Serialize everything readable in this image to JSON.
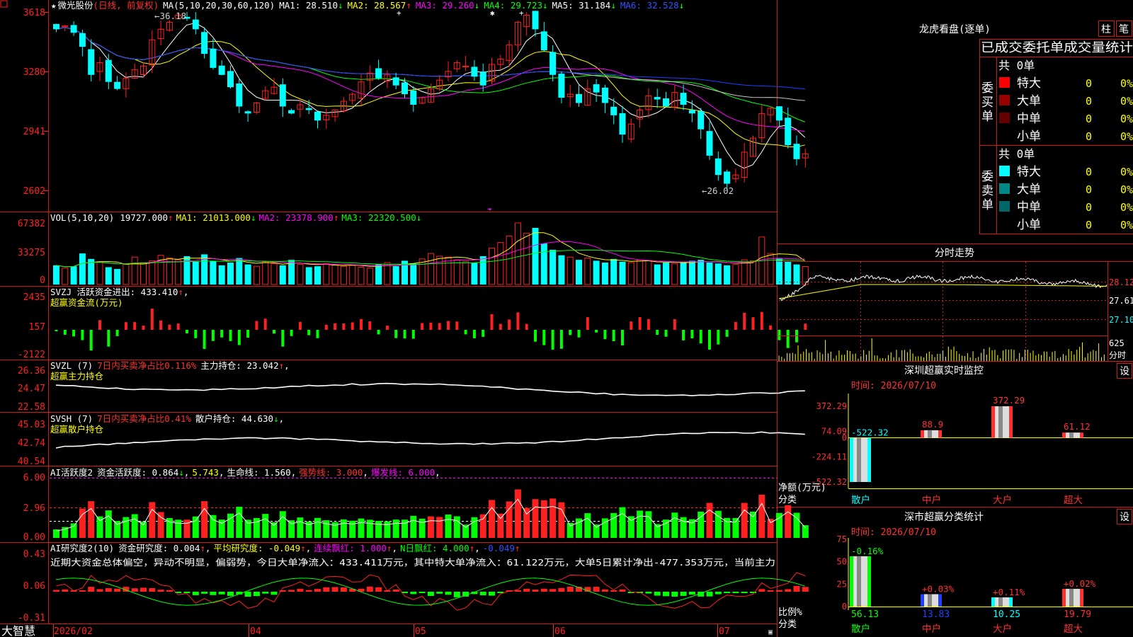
{
  "app": {
    "brand": "大智慧",
    "star": "★",
    "stock_name": "微光股份",
    "period_label": "(日线, 前复权)",
    "high_mark": "←36.18",
    "low_mark": "←26.02"
  },
  "colors": {
    "up": "#ff2020",
    "down": "#00ffff",
    "axis": "#ff2020",
    "ma1": "#ffffff",
    "ma2": "#ffff00",
    "ma3": "#ff00ff",
    "ma4": "#00ff00",
    "ma5": "#c8c8c8",
    "ma6": "#2040ff",
    "text_yellow": "#ffff00",
    "text_white": "#ffffff",
    "text_red": "#ff3030",
    "green": "#00ff00",
    "magenta": "#ff00ff"
  },
  "price_panel": {
    "y_ticks": [
      "3618",
      "3280",
      "2941",
      "2602"
    ],
    "y_values": [
      36.18,
      32.8,
      29.41,
      26.02
    ],
    "ma_header": {
      "label": "MA(5,10,20,30,60,120)",
      "ma1": "MA1: 28.510",
      "ma1_arrow": "↓",
      "ma2": "MA2: 28.567",
      "ma2_arrow": "↑",
      "ma3": "MA3: 29.260",
      "ma3_arrow": "↓",
      "ma4": "MA4: 29.723",
      "ma4_arrow": "↓",
      "ma5": "MA5: 31.184",
      "ma5_arrow": "↓",
      "ma6": "MA6: 32.528",
      "ma6_arrow": "↓"
    }
  },
  "vol_panel": {
    "y_ticks": [
      "67382",
      "33275",
      "0"
    ],
    "header": {
      "label": "VOL(5,10,20)",
      "value": "19727.000",
      "value_arrow": "↑",
      "ma1": "MA1: 21013.000",
      "ma1_arrow": "↓",
      "ma2": "MA2: 23378.900",
      "ma2_arrow": "↑",
      "ma3": "MA3: 22320.500",
      "ma3_arrow": "↓"
    }
  },
  "svzj_panel": {
    "y_ticks": [
      "2435",
      "157",
      "-2122"
    ],
    "header1": "SVZJ  活跃资金进出: 433.410",
    "header1_arrow": "↑",
    "header2": "超赢资金流(万元)"
  },
  "svzl_panel": {
    "y_ticks": [
      "26.36",
      "24.47",
      "22.58"
    ],
    "h_name": "SVZL (7)",
    "h_ratio": "7日内买卖净占比0.116%",
    "h_hold": "主力持仓: 23.042",
    "h_arrow": "↑",
    "sub": "超赢主力持仓"
  },
  "svsh_panel": {
    "y_ticks": [
      "45.03",
      "42.74",
      "40.54"
    ],
    "h_name": "SVSH (7)",
    "h_ratio": "7日内买卖净占比0.41%",
    "h_hold": "散户持仓: 44.630",
    "h_arrow": "↓",
    "sub": "超赢散户持仓"
  },
  "ai_act_panel": {
    "y_ticks": [
      "6.00",
      "2.96",
      "0.00"
    ],
    "h_name": "AI活跃度2",
    "h_act": "资金活跃度: 0.864",
    "h_act_arrow": "↓",
    "h_v2": "5.743",
    "h_life": "生命线: 1.560",
    "h_strong": "强势线: 3.000",
    "h_burst": "爆发线: 6.000"
  },
  "ai_research_panel": {
    "y_ticks": [
      "0.43",
      "0.06",
      "-0.31"
    ],
    "h_name": "AI研究度2(10)",
    "h_r": "资金研究度: 0.004",
    "h_r_arrow": "↑",
    "h_avg": "平均研究度: -0.049",
    "h_avg_arrow": "↑",
    "h_cont": "连续飘红: 1.000",
    "h_cont_arrow": "↑",
    "h_n": "N日飘红: 4.000",
    "h_n_arrow": "↑",
    "h_last": "-0.049",
    "h_last_arrow": "↑",
    "commentary": "近期大资金总体偏空，异动不明显，偏弱势，今日大单净流入：433.411万元，其中特大单净流入：61.122万元，大单5日累计净出-477.353万元，当前主力"
  },
  "x_axis": {
    "labels": [
      "2026/02",
      "04",
      "05",
      "06",
      "07"
    ]
  },
  "right": {
    "lhb": {
      "title": "龙虎看盘(逐单)",
      "btn_bar": "柱",
      "btn_pen": "笔",
      "subtitle": "已成交委托单成交量统计",
      "buy_group": "委买单",
      "sell_group": "委卖单",
      "buy_total": "共 0单",
      "sell_total": "共 0单",
      "buy_rows": [
        {
          "name": "特大",
          "count": "0",
          "pct": "0%",
          "color": "#ff0000"
        },
        {
          "name": "大单",
          "count": "0",
          "pct": "0%",
          "color": "#990000"
        },
        {
          "name": "中单",
          "count": "0",
          "pct": "0%",
          "color": "#660000"
        },
        {
          "name": "小单",
          "count": "0",
          "pct": "0%",
          "color": "#000000"
        }
      ],
      "sell_rows": [
        {
          "name": "特大",
          "count": "0",
          "pct": "0%",
          "color": "#00ffff"
        },
        {
          "name": "大单",
          "count": "0",
          "pct": "0%",
          "color": "#008888"
        },
        {
          "name": "中单",
          "count": "0",
          "pct": "0%",
          "color": "#006666"
        },
        {
          "name": "小单",
          "count": "0",
          "pct": "0%",
          "color": "#000000"
        }
      ]
    },
    "intraday": {
      "title": "分时走势",
      "y_labels": [
        "28.12",
        "27.61",
        "27.10"
      ],
      "vol_label": "625",
      "vol_label2": "分时"
    },
    "sz_monitor": {
      "title": "深圳超赢实时监控",
      "btn": "设",
      "time": "时间: 2026/07/10",
      "y_ticks": [
        "372.29",
        "74.09",
        "0",
        "-224.11",
        "-522.32"
      ],
      "axis_label1": "净额(万元)",
      "axis_label2": "分类",
      "categories": [
        "散户",
        "中户",
        "大户",
        "超大"
      ],
      "values": [
        -522.32,
        88.9,
        372.29,
        61.12
      ],
      "value_labels": [
        "-522.32",
        "88.9",
        "372.29",
        "61.12"
      ]
    },
    "sz_class": {
      "title": "深市超赢分类统计",
      "btn": "设",
      "time": "时间: 2026/07/10",
      "y_ticks": [
        "75",
        "50",
        "25",
        "0"
      ],
      "axis_label1": "比例%",
      "axis_label2": "分类",
      "categories": [
        "散户",
        "中户",
        "大户",
        "超大"
      ],
      "values": [
        56.13,
        13.83,
        10.25,
        19.79
      ],
      "value_labels": [
        "56.13",
        "13.83",
        "10.25",
        "19.79"
      ],
      "change_labels": [
        "-0.16%",
        "+0.03%",
        "+0.11%",
        "+0.02%"
      ]
    }
  },
  "chart_data": [
    {
      "type": "candlestick",
      "title": "微光股份 (日线, 前复权)",
      "x_range": [
        "2026/02",
        "2026/07/10"
      ],
      "ylim": [
        26.02,
        36.18
      ],
      "high": 36.18,
      "low": 26.02,
      "close": [
        35.2,
        35.4,
        35.0,
        34.2,
        32.6,
        33.3,
        32.2,
        31.8,
        32.4,
        32.9,
        33.1,
        34.6,
        35.2,
        35.6,
        36.0,
        35.8,
        35.2,
        33.8,
        33.0,
        32.6,
        31.9,
        30.8,
        30.4,
        31.0,
        31.7,
        31.9,
        30.8,
        30.4,
        30.9,
        30.6,
        30.0,
        30.3,
        30.6,
        31.1,
        31.5,
        32.2,
        32.7,
        32.4,
        32.6,
        32.0,
        31.5,
        30.9,
        31.3,
        31.8,
        32.3,
        32.8,
        33.3,
        33.1,
        32.5,
        32.0,
        33.2,
        33.5,
        34.3,
        35.6,
        36.0,
        35.2,
        34.0,
        32.6,
        31.3,
        31.5,
        31.0,
        31.8,
        31.6,
        31.0,
        30.3,
        29.2,
        29.8,
        30.6,
        31.4,
        31.2,
        30.8,
        31.6,
        30.9,
        30.4,
        29.5,
        28.0,
        26.9,
        26.4,
        26.9,
        28.2,
        29.0,
        30.4,
        30.7,
        30.0,
        28.6,
        27.8,
        28.1
      ],
      "volume": [
        21000,
        18000,
        20000,
        34000,
        28000,
        25000,
        19000,
        17000,
        22000,
        30000,
        24000,
        26000,
        32000,
        29000,
        27000,
        31000,
        25000,
        33000,
        26000,
        21000,
        24000,
        29000,
        22000,
        20000,
        25000,
        23000,
        21000,
        27000,
        22000,
        19000,
        20000,
        23000,
        22000,
        20000,
        21000,
        19000,
        18000,
        22000,
        24000,
        20000,
        26000,
        23000,
        28000,
        34000,
        31000,
        30000,
        27000,
        25000,
        24000,
        31000,
        40000,
        46000,
        53000,
        67382,
        56000,
        62000,
        45000,
        38000,
        32000,
        30000,
        27000,
        29000,
        26000,
        24000,
        28000,
        25000,
        24000,
        27000,
        26000,
        22000,
        24000,
        23000,
        25000,
        26000,
        27000,
        24000,
        23000,
        21000,
        22000,
        27000,
        26000,
        52000,
        34000,
        29000,
        25000,
        22000,
        19727
      ],
      "series": [
        {
          "name": "MA1",
          "last": 28.51
        },
        {
          "name": "MA2",
          "last": 28.567
        },
        {
          "name": "MA3",
          "last": 29.26
        },
        {
          "name": "MA4",
          "last": 29.723
        },
        {
          "name": "MA5",
          "last": 31.184
        },
        {
          "name": "MA6",
          "last": 32.528
        }
      ]
    },
    {
      "type": "bar",
      "title": "深圳超赢实时监控",
      "categories": [
        "散户",
        "中户",
        "大户",
        "超大"
      ],
      "values": [
        -522.32,
        88.9,
        372.29,
        61.12
      ],
      "ylabel": "净额(万元)",
      "ylim": [
        -522.32,
        372.29
      ]
    },
    {
      "type": "bar",
      "title": "深市超赢分类统计",
      "categories": [
        "散户",
        "中户",
        "大户",
        "超大"
      ],
      "values": [
        56.13,
        13.83,
        10.25,
        19.79
      ],
      "ylabel": "比例%",
      "ylim": [
        0,
        75
      ]
    }
  ]
}
